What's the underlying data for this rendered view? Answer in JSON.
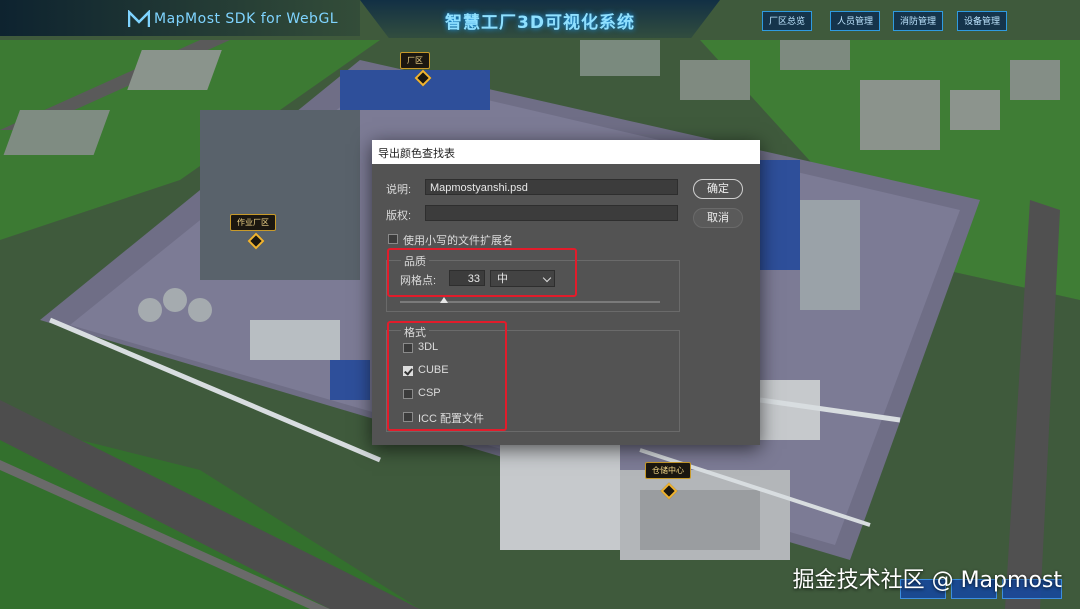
{
  "app": {
    "logo_text": "MapMost SDK for WebGL",
    "title": "智慧工厂3D可视化系统",
    "nav": [
      "厂区总览",
      "人员管理",
      "消防管理",
      "设备管理"
    ]
  },
  "scene": {
    "tags": [
      "厂区",
      "作业厂区",
      "仓储中心"
    ]
  },
  "dialog": {
    "title": "导出颜色查找表",
    "description_label": "说明:",
    "description_value": "Mapmostyanshi.psd",
    "copyright_label": "版权:",
    "copyright_value": "",
    "lowercase_ext_label": "使用小写的文件扩展名",
    "lowercase_ext_checked": false,
    "ok_button": "确定",
    "cancel_button": "取消",
    "quality": {
      "legend": "品质",
      "grid_points_label": "网格点:",
      "grid_points_value": "33",
      "preset_value": "中",
      "slider_fraction": 0.17
    },
    "formats": {
      "legend": "格式",
      "items": [
        {
          "label": "3DL",
          "checked": false
        },
        {
          "label": "CUBE",
          "checked": true
        },
        {
          "label": "CSP",
          "checked": false
        },
        {
          "label": "ICC 配置文件",
          "checked": false
        }
      ]
    }
  },
  "watermark": "掘金技术社区 @ Mapmost",
  "colors": {
    "dialog_bg": "#535353",
    "highlight_red": "#e21c2b",
    "hud_accent": "#2f9be0"
  }
}
